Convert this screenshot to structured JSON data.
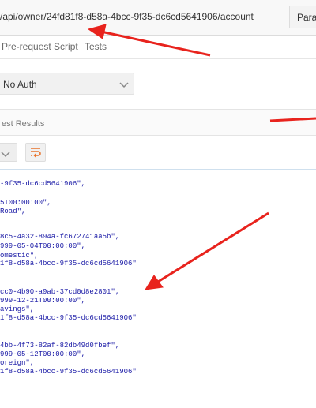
{
  "request": {
    "url": "/api/owner/24fd81f8-d58a-4bcc-9f35-dc6cd5641906/account",
    "params_label": "Params"
  },
  "tabs": [
    {
      "label": "Pre-request Script"
    },
    {
      "label": "Tests"
    }
  ],
  "auth": {
    "type": "No Auth"
  },
  "results": {
    "label": "est Results"
  },
  "response_lines": [
    "-9f35-dc6cd5641906\",",
    "5T00:00:00\",",
    "Road\",",
    "8c5-4a32-894a-fc672741aa5b\",",
    "999-05-04T00:00:00\",",
    "omestic\",",
    "1f8-d58a-4bcc-9f35-dc6cd5641906\"",
    "cc0-4b90-a9ab-37cd0d8e2801\",",
    "999-12-21T00:00:00\",",
    "avings\",",
    "1f8-d58a-4bcc-9f35-dc6cd5641906\"",
    "4bb-4f73-82af-82db49d0fbef\",",
    "999-05-12T00:00:00\",",
    "oreign\",",
    "1f8-d58a-4bcc-9f35-dc6cd5641906\""
  ],
  "colors": {
    "json_string": "#1a1aa6",
    "arrow": "#e8231d",
    "wrap_icon": "#e8722a"
  }
}
